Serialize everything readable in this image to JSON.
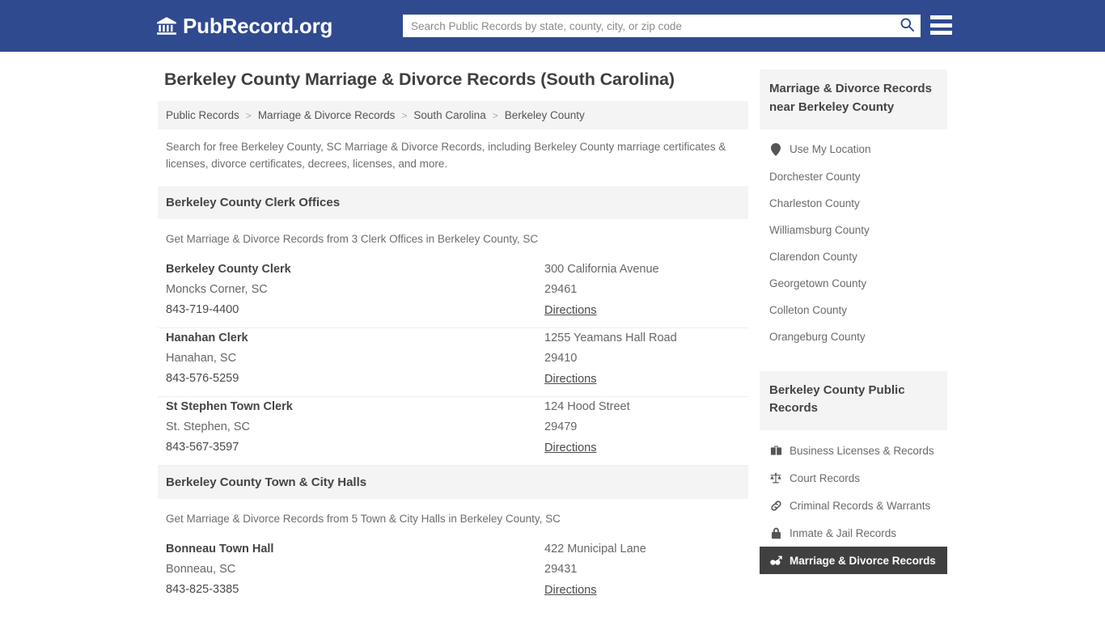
{
  "header": {
    "brand_icon": "bank-building-icon",
    "brand_text": "PubRecord.org",
    "search": {
      "placeholder": "Search Public Records by state, county, city, or zip code",
      "value": "",
      "icon": "search-icon"
    },
    "menu_icon": "hamburger-menu-icon",
    "background_color": "#2f4a8f"
  },
  "page_title": "Berkeley County Marriage & Divorce Records (South Carolina)",
  "breadcrumb": [
    "Public Records",
    "Marriage & Divorce Records",
    "South Carolina",
    "Berkeley County"
  ],
  "breadcrumb_separator": ">",
  "intro": "Search for free Berkeley County, SC Marriage & Divorce Records, including Berkeley County marriage certificates & licenses, divorce certificates, decrees, licenses, and more.",
  "sections": [
    {
      "title": "Berkeley County Clerk Offices",
      "subtitle": "Get Marriage & Divorce Records from 3 Clerk Offices in Berkeley County, SC",
      "listings": [
        {
          "name": "Berkeley County Clerk",
          "city_state": "Moncks Corner, SC",
          "phone": "843-719-4400",
          "address": "300 California Avenue",
          "zip": "29461",
          "directions": "Directions"
        },
        {
          "name": "Hanahan Clerk",
          "city_state": "Hanahan, SC",
          "phone": "843-576-5259",
          "address": "1255 Yeamans Hall Road",
          "zip": "29410",
          "directions": "Directions"
        },
        {
          "name": "St Stephen Town Clerk",
          "city_state": "St. Stephen, SC",
          "phone": "843-567-3597",
          "address": "124 Hood Street",
          "zip": "29479",
          "directions": "Directions"
        }
      ]
    },
    {
      "title": "Berkeley County Town & City Halls",
      "subtitle": "Get Marriage & Divorce Records from 5 Town & City Halls in Berkeley County, SC",
      "listings": [
        {
          "name": "Bonneau Town Hall",
          "city_state": "Bonneau, SC",
          "phone": "843-825-3385",
          "address": "422 Municipal Lane",
          "zip": "29431",
          "directions": "Directions"
        }
      ]
    }
  ],
  "sidebar": {
    "nearby": {
      "heading": "Marriage & Divorce Records near Berkeley County",
      "items": [
        {
          "label": "Use My Location",
          "icon": "map-pin-icon"
        },
        {
          "label": "Dorchester County",
          "icon": ""
        },
        {
          "label": "Charleston County",
          "icon": ""
        },
        {
          "label": "Williamsburg County",
          "icon": ""
        },
        {
          "label": "Clarendon County",
          "icon": ""
        },
        {
          "label": "Georgetown County",
          "icon": ""
        },
        {
          "label": "Colleton County",
          "icon": ""
        },
        {
          "label": "Orangeburg County",
          "icon": ""
        }
      ]
    },
    "public_records": {
      "heading": "Berkeley County Public Records",
      "items": [
        {
          "label": "Business Licenses & Records",
          "icon": "briefcase-icon",
          "active": false
        },
        {
          "label": "Court Records",
          "icon": "scales-of-justice-icon",
          "active": false
        },
        {
          "label": "Criminal Records & Warrants",
          "icon": "chain-link-icon",
          "active": false
        },
        {
          "label": "Inmate & Jail Records",
          "icon": "lock-icon",
          "active": false
        },
        {
          "label": "Marriage & Divorce Records",
          "icon": "mars-venus-icon",
          "active": true
        }
      ],
      "active_background_color": "#404040"
    }
  }
}
